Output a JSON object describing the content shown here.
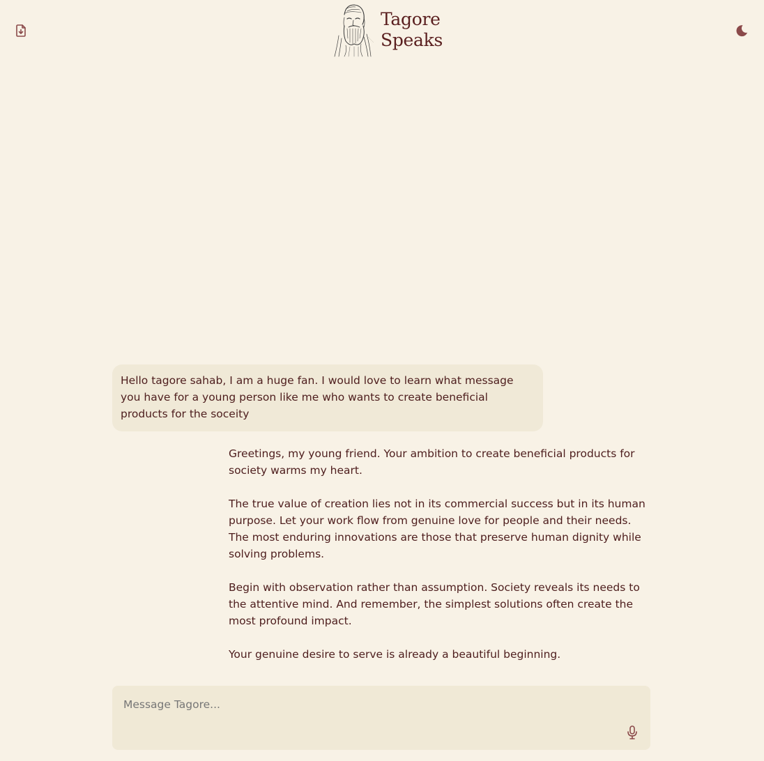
{
  "header": {
    "title_line1": "Tagore",
    "title_line2": "Speaks",
    "export_icon": "file-download-icon",
    "theme_icon": "moon-icon"
  },
  "conversation": {
    "user_message": "Hello tagore sahab, I am a huge fan. I would love to learn what message you have for a young person like me who wants to create beneficial products for the soceity",
    "assistant_paragraphs": [
      "Greetings, my young friend. Your ambition to create beneficial products for society warms my heart.",
      "The true value of creation lies not in its commercial success but in its human purpose. Let your work flow from genuine love for people and their needs. The most enduring innovations are those that preserve human dignity while solving problems.",
      "Begin with observation rather than assumption. Society reveals its needs to the attentive mind. And remember, the simplest solutions often create the most profound impact.",
      "Your genuine desire to serve is already a beautiful beginning."
    ]
  },
  "composer": {
    "placeholder": "Message Tagore...",
    "value": "",
    "mic_icon": "microphone-icon"
  },
  "colors": {
    "background": "#f8f2e6",
    "surface": "#f0e9d7",
    "text": "#4d1d1d",
    "accent": "#8b4a4a"
  }
}
